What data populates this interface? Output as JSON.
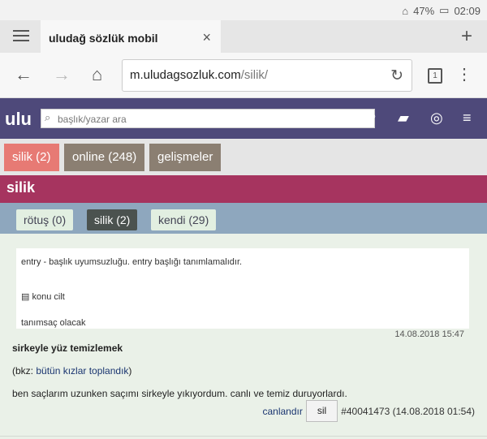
{
  "status": {
    "battery": "47%",
    "time": "02:09"
  },
  "browser": {
    "tab_title": "uludağ sözlük mobil",
    "url_domain": "m.uludagsozluk.com",
    "url_path": "/silik/",
    "tab_count": "1"
  },
  "site": {
    "logo": "ulu",
    "search_placeholder": "başlık/yazar ara"
  },
  "filters": [
    {
      "label": "silik (2)",
      "color": "#e77a74"
    },
    {
      "label": "online (248)",
      "color": "#8b7f72"
    },
    {
      "label": "gelişmeler",
      "color": "#8b7f72"
    }
  ],
  "page_title": "silik",
  "subtabs": [
    {
      "label": "rötuş (0)"
    },
    {
      "label": "silik (2)",
      "active": true
    },
    {
      "label": "kendi (29)"
    }
  ],
  "notice": {
    "message": "entry - başlık uyumsuzluğu. entry başlığı tanımlamalıdır.",
    "book_label": "konu cilt",
    "follow_up": "tanımsaç olacak",
    "date": "14.08.2018 15:47"
  },
  "entry": {
    "title": "sirkeyle yüz temizlemek",
    "bkz_prefix": "(bkz: ",
    "bkz_link": "bütün kızlar toplandık",
    "bkz_suffix": ")",
    "text": "ben saçlarım uzunken saçımı sirkeyle yıkıyordum. canlı ve temiz duruyorlardı.",
    "canlandir": "canlandır",
    "sil": "sil",
    "meta": "#40041473 (14.08.2018 01:54)"
  }
}
